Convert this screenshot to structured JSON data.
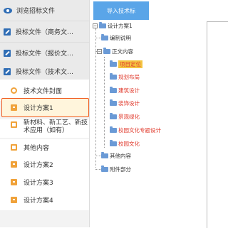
{
  "sidebar": {
    "groups": [
      {
        "label": "浏览招标文件",
        "icon": "eye-icon"
      },
      {
        "label": "投标文件（商务文…",
        "icon": "edit-icon"
      },
      {
        "label": "投标文件（报价文…",
        "icon": "edit-icon"
      },
      {
        "label": "投标文件（技术文…",
        "icon": "edit-icon"
      }
    ],
    "items": [
      {
        "label": "技术文件封面",
        "icon": "search-doc-icon"
      },
      {
        "label": "设计方案1",
        "icon": "document-icon",
        "selected": true
      },
      {
        "label": "新材料、新工艺、新技术应用（如有）",
        "icon": "document-icon"
      },
      {
        "label": "其他内容",
        "icon": "document-icon"
      },
      {
        "label": "设计方案2",
        "icon": "document-icon"
      },
      {
        "label": "设计方案3",
        "icon": "document-icon"
      },
      {
        "label": "设计方案4",
        "icon": "document-icon"
      }
    ]
  },
  "toolbar": {
    "import_label": "导入技术标"
  },
  "tree": {
    "root": "设计方案1",
    "n1": "编制说明",
    "n2": "正文内容",
    "c1": "项目定位",
    "c2": "规划布局",
    "c3": "建筑设计",
    "c4": "装饰设计",
    "c5": "景观绿化",
    "c6": "校园文化专题设计",
    "c7": "校园文化",
    "n3": "其他内容",
    "n4": "附件部分"
  },
  "colors": {
    "accent": "#5aa5e8",
    "highlight": "#f4c542",
    "red_text": "#e03a2c",
    "selected_border": "#f05a1e"
  }
}
